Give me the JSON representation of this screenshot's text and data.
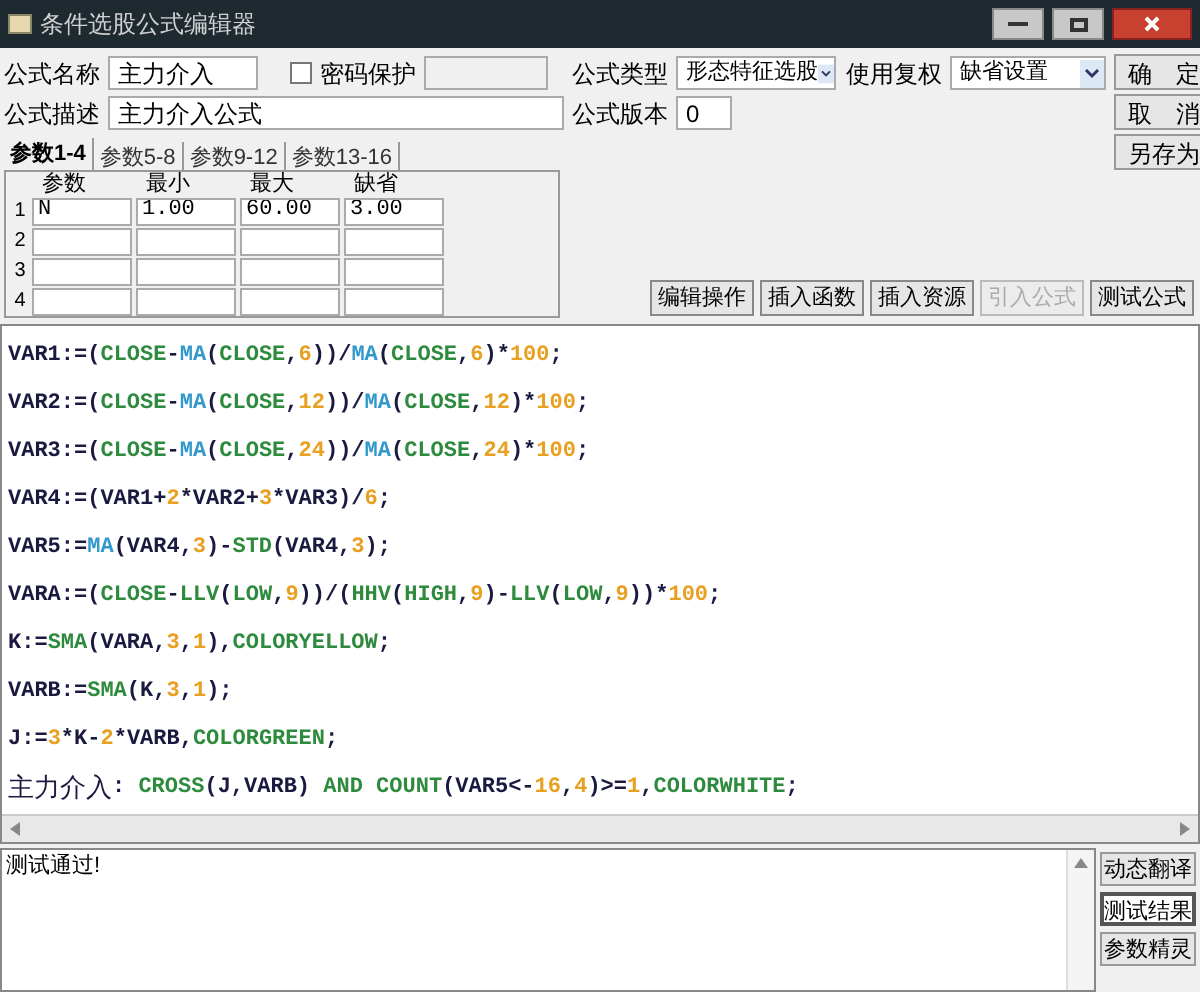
{
  "window": {
    "title": "条件选股公式编辑器"
  },
  "form": {
    "name_label": "公式名称",
    "name_value": "主力介入",
    "password": {
      "label": "密码保护",
      "checked": false
    },
    "desc_label": "公式描述",
    "desc_value": "主力介入公式",
    "type_label": "公式类型",
    "type_value": "形态特征选股",
    "rights_label": "使用复权",
    "rights_value": "缺省设置",
    "version_label": "公式版本",
    "version_value": "0"
  },
  "side_buttons": [
    "确　定",
    "取　消",
    "另存为"
  ],
  "param_tabs": [
    {
      "label": "参数1-4",
      "selected": true
    },
    {
      "label": "参数5-8",
      "selected": false
    },
    {
      "label": "参数9-12",
      "selected": false
    },
    {
      "label": "参数13-16",
      "selected": false
    }
  ],
  "params": {
    "columns": [
      "参数",
      "最小",
      "最大",
      "缺省"
    ],
    "rows": [
      {
        "index": "1",
        "cells": [
          "N",
          "1.00",
          "60.00",
          "3.00"
        ]
      },
      {
        "index": "2",
        "cells": []
      },
      {
        "index": "3",
        "cells": []
      },
      {
        "index": "4",
        "cells": []
      }
    ]
  },
  "tool_buttons": [
    {
      "label": "编辑操作",
      "disabled": false
    },
    {
      "label": "插入函数",
      "disabled": false
    },
    {
      "label": "插入资源",
      "disabled": false
    },
    {
      "label": "引入公式",
      "disabled": true
    },
    {
      "label": "测试公式",
      "disabled": false
    }
  ],
  "code_lines": [
    [
      {
        "text": "VAR1:=(",
        "color": "#1a1a40"
      },
      {
        "text": "CLOSE",
        "color": "#2e8b3e"
      },
      {
        "text": "-",
        "color": "#1a1a40"
      },
      {
        "text": "MA",
        "color": "#3399cc"
      },
      {
        "text": "(",
        "color": "#1a1a40"
      },
      {
        "text": "CLOSE",
        "color": "#2e8b3e"
      },
      {
        "text": ",",
        "color": "#1a1a40"
      },
      {
        "text": "6",
        "color": "#e8a020"
      },
      {
        "text": "))/",
        "color": "#1a1a40"
      },
      {
        "text": "MA",
        "color": "#3399cc"
      },
      {
        "text": "(",
        "color": "#1a1a40"
      },
      {
        "text": "CLOSE",
        "color": "#2e8b3e"
      },
      {
        "text": ",",
        "color": "#1a1a40"
      },
      {
        "text": "6",
        "color": "#e8a020"
      },
      {
        "text": ")*",
        "color": "#1a1a40"
      },
      {
        "text": "100",
        "color": "#e8a020"
      },
      {
        "text": ";",
        "color": "#1a1a40"
      }
    ],
    [
      {
        "text": "VAR2:=(",
        "color": "#1a1a40"
      },
      {
        "text": "CLOSE",
        "color": "#2e8b3e"
      },
      {
        "text": "-",
        "color": "#1a1a40"
      },
      {
        "text": "MA",
        "color": "#3399cc"
      },
      {
        "text": "(",
        "color": "#1a1a40"
      },
      {
        "text": "CLOSE",
        "color": "#2e8b3e"
      },
      {
        "text": ",",
        "color": "#1a1a40"
      },
      {
        "text": "12",
        "color": "#e8a020"
      },
      {
        "text": "))/",
        "color": "#1a1a40"
      },
      {
        "text": "MA",
        "color": "#3399cc"
      },
      {
        "text": "(",
        "color": "#1a1a40"
      },
      {
        "text": "CLOSE",
        "color": "#2e8b3e"
      },
      {
        "text": ",",
        "color": "#1a1a40"
      },
      {
        "text": "12",
        "color": "#e8a020"
      },
      {
        "text": ")*",
        "color": "#1a1a40"
      },
      {
        "text": "100",
        "color": "#e8a020"
      },
      {
        "text": ";",
        "color": "#1a1a40"
      }
    ],
    [
      {
        "text": "VAR3:=(",
        "color": "#1a1a40"
      },
      {
        "text": "CLOSE",
        "color": "#2e8b3e"
      },
      {
        "text": "-",
        "color": "#1a1a40"
      },
      {
        "text": "MA",
        "color": "#3399cc"
      },
      {
        "text": "(",
        "color": "#1a1a40"
      },
      {
        "text": "CLOSE",
        "color": "#2e8b3e"
      },
      {
        "text": ",",
        "color": "#1a1a40"
      },
      {
        "text": "24",
        "color": "#e8a020"
      },
      {
        "text": "))/",
        "color": "#1a1a40"
      },
      {
        "text": "MA",
        "color": "#3399cc"
      },
      {
        "text": "(",
        "color": "#1a1a40"
      },
      {
        "text": "CLOSE",
        "color": "#2e8b3e"
      },
      {
        "text": ",",
        "color": "#1a1a40"
      },
      {
        "text": "24",
        "color": "#e8a020"
      },
      {
        "text": ")*",
        "color": "#1a1a40"
      },
      {
        "text": "100",
        "color": "#e8a020"
      },
      {
        "text": ";",
        "color": "#1a1a40"
      }
    ],
    [
      {
        "text": "VAR4:=(VAR1+",
        "color": "#1a1a40"
      },
      {
        "text": "2",
        "color": "#e8a020"
      },
      {
        "text": "*VAR2+",
        "color": "#1a1a40"
      },
      {
        "text": "3",
        "color": "#e8a020"
      },
      {
        "text": "*VAR3)/",
        "color": "#1a1a40"
      },
      {
        "text": "6",
        "color": "#e8a020"
      },
      {
        "text": ";",
        "color": "#1a1a40"
      }
    ],
    [
      {
        "text": "VAR5:=",
        "color": "#1a1a40"
      },
      {
        "text": "MA",
        "color": "#3399cc"
      },
      {
        "text": "(VAR4,",
        "color": "#1a1a40"
      },
      {
        "text": "3",
        "color": "#e8a020"
      },
      {
        "text": ")-",
        "color": "#1a1a40"
      },
      {
        "text": "STD",
        "color": "#2e8b3e"
      },
      {
        "text": "(VAR4,",
        "color": "#1a1a40"
      },
      {
        "text": "3",
        "color": "#e8a020"
      },
      {
        "text": ");",
        "color": "#1a1a40"
      }
    ],
    [
      {
        "text": "VARA:=(",
        "color": "#1a1a40"
      },
      {
        "text": "CLOSE",
        "color": "#2e8b3e"
      },
      {
        "text": "-",
        "color": "#1a1a40"
      },
      {
        "text": "LLV",
        "color": "#2e8b3e"
      },
      {
        "text": "(",
        "color": "#1a1a40"
      },
      {
        "text": "LOW",
        "color": "#2e8b3e"
      },
      {
        "text": ",",
        "color": "#1a1a40"
      },
      {
        "text": "9",
        "color": "#e8a020"
      },
      {
        "text": "))/(",
        "color": "#1a1a40"
      },
      {
        "text": "HHV",
        "color": "#2e8b3e"
      },
      {
        "text": "(",
        "color": "#1a1a40"
      },
      {
        "text": "HIGH",
        "color": "#2e8b3e"
      },
      {
        "text": ",",
        "color": "#1a1a40"
      },
      {
        "text": "9",
        "color": "#e8a020"
      },
      {
        "text": ")-",
        "color": "#1a1a40"
      },
      {
        "text": "LLV",
        "color": "#2e8b3e"
      },
      {
        "text": "(",
        "color": "#1a1a40"
      },
      {
        "text": "LOW",
        "color": "#2e8b3e"
      },
      {
        "text": ",",
        "color": "#1a1a40"
      },
      {
        "text": "9",
        "color": "#e8a020"
      },
      {
        "text": "))*",
        "color": "#1a1a40"
      },
      {
        "text": "100",
        "color": "#e8a020"
      },
      {
        "text": ";",
        "color": "#1a1a40"
      }
    ],
    [
      {
        "text": "K:=",
        "color": "#1a1a40"
      },
      {
        "text": "SMA",
        "color": "#2e8b3e"
      },
      {
        "text": "(VARA,",
        "color": "#1a1a40"
      },
      {
        "text": "3",
        "color": "#e8a020"
      },
      {
        "text": ",",
        "color": "#1a1a40"
      },
      {
        "text": "1",
        "color": "#e8a020"
      },
      {
        "text": "),",
        "color": "#1a1a40"
      },
      {
        "text": "COLORYELLOW",
        "color": "#2e8b3e"
      },
      {
        "text": ";",
        "color": "#1a1a40"
      }
    ],
    [
      {
        "text": "VARB:=",
        "color": "#1a1a40"
      },
      {
        "text": "SMA",
        "color": "#2e8b3e"
      },
      {
        "text": "(K,",
        "color": "#1a1a40"
      },
      {
        "text": "3",
        "color": "#e8a020"
      },
      {
        "text": ",",
        "color": "#1a1a40"
      },
      {
        "text": "1",
        "color": "#e8a020"
      },
      {
        "text": ");",
        "color": "#1a1a40"
      }
    ],
    [
      {
        "text": "J:=",
        "color": "#1a1a40"
      },
      {
        "text": "3",
        "color": "#e8a020"
      },
      {
        "text": "*K-",
        "color": "#1a1a40"
      },
      {
        "text": "2",
        "color": "#e8a020"
      },
      {
        "text": "*VARB,",
        "color": "#1a1a40"
      },
      {
        "text": "COLORGREEN",
        "color": "#2e8b3e"
      },
      {
        "text": ";",
        "color": "#1a1a40"
      }
    ],
    [
      {
        "text": "主力介入",
        "color": "#1a1a40",
        "kind": "name"
      },
      {
        "text": ": ",
        "color": "#1a1a40"
      },
      {
        "text": "CROSS",
        "color": "#2e8b3e"
      },
      {
        "text": "(J,VARB) ",
        "color": "#1a1a40"
      },
      {
        "text": "AND ",
        "color": "#2e8b3e"
      },
      {
        "text": "COUNT",
        "color": "#2e8b3e"
      },
      {
        "text": "(VAR5<-",
        "color": "#1a1a40"
      },
      {
        "text": "16",
        "color": "#e8a020"
      },
      {
        "text": ",",
        "color": "#1a1a40"
      },
      {
        "text": "4",
        "color": "#e8a020"
      },
      {
        "text": ")>=",
        "color": "#1a1a40"
      },
      {
        "text": "1",
        "color": "#e8a020"
      },
      {
        "text": ",",
        "color": "#1a1a40"
      },
      {
        "text": "COLORWHITE",
        "color": "#2e8b3e"
      },
      {
        "text": ";",
        "color": "#1a1a40"
      }
    ]
  ],
  "output": {
    "text": "测试通过!"
  },
  "output_buttons": [
    {
      "label": "动态翻译",
      "selected": false
    },
    {
      "label": "测试结果",
      "selected": true
    },
    {
      "label": "参数精灵",
      "selected": false
    }
  ]
}
